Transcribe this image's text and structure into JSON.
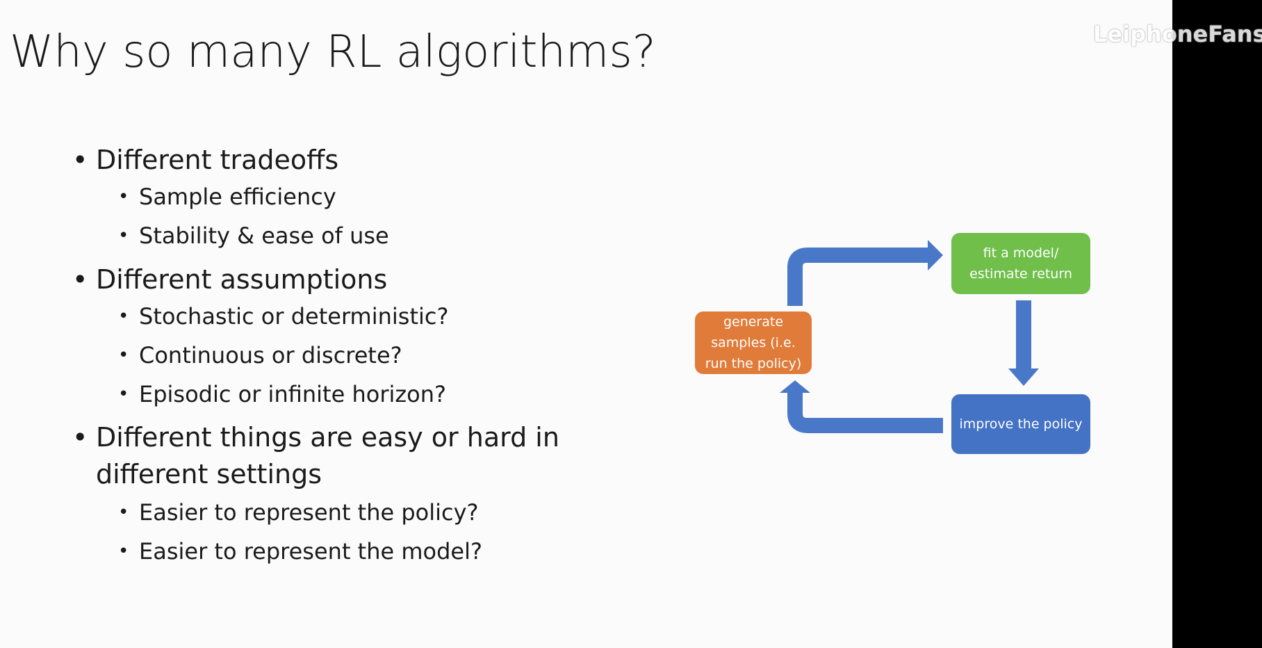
{
  "slide": {
    "title": "Why so many RL algorithms?",
    "bullets": [
      {
        "text": "Different tradeoffs",
        "sub": [
          "Sample efficiency",
          "Stability & ease of use"
        ]
      },
      {
        "text": "Different assumptions",
        "sub": [
          "Stochastic or deterministic?",
          "Continuous or discrete?",
          "Episodic or infinite horizon?"
        ]
      },
      {
        "text": "Different things are easy or hard in different settings",
        "sub": [
          "Easier to represent the policy?",
          "Easier to represent the model?"
        ]
      }
    ]
  },
  "diagram": {
    "generate": "generate samples (i.e. run the policy)",
    "fit": "fit a model/ estimate return",
    "improve": "improve the policy",
    "colors": {
      "generate": "#e07b39",
      "fit": "#70bf4a",
      "improve": "#4472c4",
      "arrow": "#4a78c8"
    }
  },
  "watermark": "LeiphoneFans"
}
